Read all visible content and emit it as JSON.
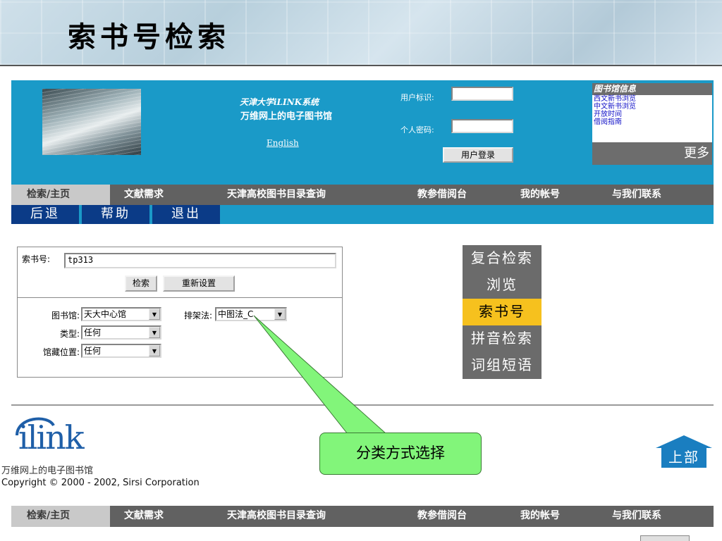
{
  "slide": {
    "title": "索书号检索"
  },
  "banner": {
    "system_line1": "天津大学iLINK系统",
    "system_line2": "万维网上的电子图书馆",
    "english": "English",
    "user_id_label": "用户标识:",
    "password_label": "个人密码:",
    "login_button": "用户登录",
    "info": {
      "title": "图书馆信息",
      "links": [
        "西文新书浏览",
        "中文新书浏览",
        "开放时间",
        "借阅指南"
      ],
      "more": "更多"
    }
  },
  "nav": {
    "items": [
      "检索/主页",
      "文献需求",
      "天津高校图书目录查询",
      "教参借阅台",
      "我的帐号",
      "与我们联系"
    ],
    "active_index": 0
  },
  "subnav": {
    "items": [
      "后退",
      "帮助",
      "退出"
    ]
  },
  "search": {
    "callno_label": "索书号:",
    "callno_value": "tp313",
    "search_button": "检索",
    "reset_button": "重新设置",
    "library_label": "图书馆:",
    "library_value": "天大中心馆",
    "shelving_label": "排架法:",
    "shelving_value": "中图法_C",
    "type_label": "类型:",
    "type_value": "任何",
    "location_label": "馆藏位置:",
    "location_value": "任何"
  },
  "side_menu": {
    "items": [
      "复合检索",
      "浏览",
      "索书号",
      "拼音检索",
      "词组短语"
    ],
    "active_index": 2,
    "active_color": "#f6c11e"
  },
  "callout": {
    "text": "分类方式选择",
    "color": "#82f57a"
  },
  "footer": {
    "logo": "ilink",
    "subtitle": "万维网上的电子图书馆",
    "copyright": "Copyright © 2000 - 2002, Sirsi Corporation",
    "top_button": "上部"
  },
  "colors": {
    "banner_blue": "#1a9ac8",
    "nav_gray": "#616161",
    "subnav_navy": "#0b3b87"
  }
}
